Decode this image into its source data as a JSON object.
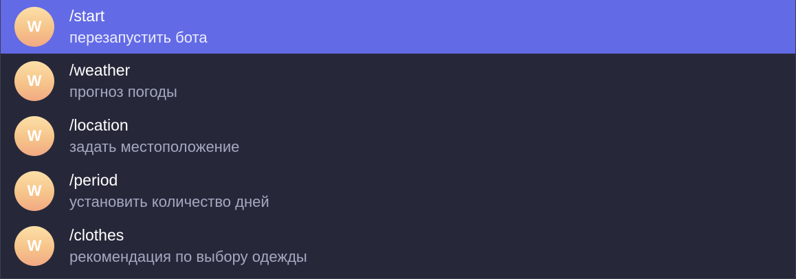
{
  "accent_color": "#636ae5",
  "commands": [
    {
      "avatar_letter": "W",
      "command": "/start",
      "description": "перезапустить бота",
      "selected": true
    },
    {
      "avatar_letter": "W",
      "command": "/weather",
      "description": "прогноз погоды",
      "selected": false
    },
    {
      "avatar_letter": "W",
      "command": "/location",
      "description": "задать местоположение",
      "selected": false
    },
    {
      "avatar_letter": "W",
      "command": "/period",
      "description": "установить количество дней",
      "selected": false
    },
    {
      "avatar_letter": "W",
      "command": "/clothes",
      "description": "рекомендация по выбору одежды",
      "selected": false
    }
  ]
}
